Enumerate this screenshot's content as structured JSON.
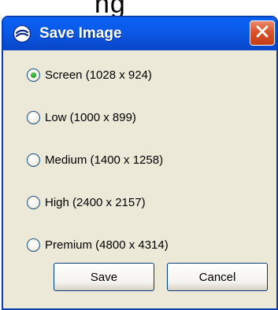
{
  "background_text": "ng",
  "window": {
    "title": "Save Image",
    "icon": "save-image-icon",
    "close_icon": "close-icon",
    "colors": {
      "titlebar": "#0a5ff0",
      "body": "#ece9d8",
      "close_button": "#d8532b",
      "radio_selected": "#24a424"
    }
  },
  "resolution_options": [
    {
      "label": "Screen (1028 x 924)",
      "selected": true
    },
    {
      "label": "Low (1000 x 899)",
      "selected": false
    },
    {
      "label": "Medium (1400 x 1258)",
      "selected": false
    },
    {
      "label": "High (2400 x 2157)",
      "selected": false
    },
    {
      "label": "Premium (4800 x 4314)",
      "selected": false
    }
  ],
  "buttons": {
    "save": "Save",
    "cancel": "Cancel"
  }
}
